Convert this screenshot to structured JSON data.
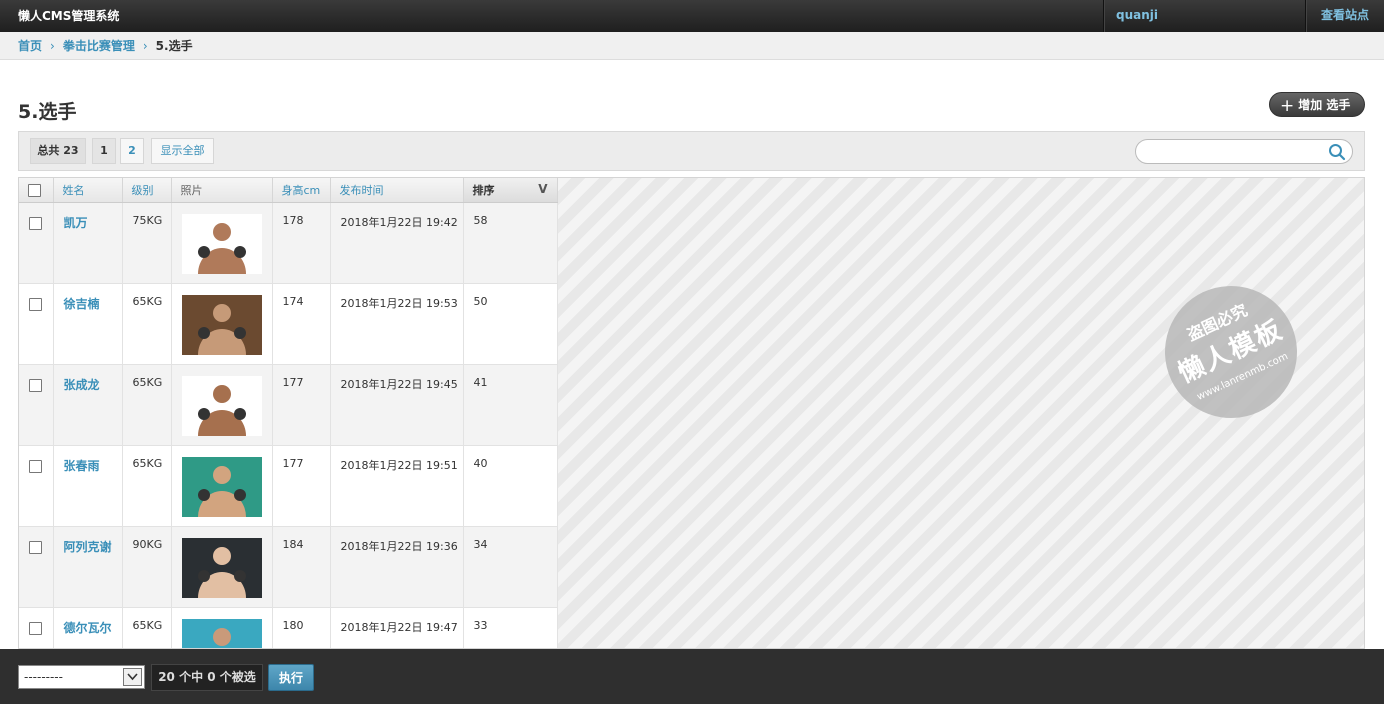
{
  "header": {
    "brand": "懒人CMS管理系统",
    "user": "quanji",
    "view_site": "查看站点"
  },
  "breadcrumb": {
    "home": "首页",
    "section": "拳击比赛管理",
    "current": "5.选手"
  },
  "page": {
    "title": "5.选手",
    "add_button": "增加 选手"
  },
  "toolbar": {
    "total": "总共 23",
    "page1": "1",
    "page2": "2",
    "show_all": "显示全部",
    "search_value": ""
  },
  "table": {
    "headers": {
      "name": "姓名",
      "weight": "级别",
      "photo": "照片",
      "height": "身高cm",
      "published": "发布时间",
      "order": "排序"
    },
    "rows": [
      {
        "name": "凯万",
        "weight": "75KG",
        "height": "178",
        "published": "2018年1月22日 19:42",
        "order": "58",
        "photo_bg": "#ffffff",
        "skin": "#b07a5a"
      },
      {
        "name": "徐吉楠",
        "weight": "65KG",
        "height": "174",
        "published": "2018年1月22日 19:53",
        "order": "50",
        "photo_bg": "#6b4a30",
        "skin": "#c69a78"
      },
      {
        "name": "张成龙",
        "weight": "65KG",
        "height": "177",
        "published": "2018年1月22日 19:45",
        "order": "41",
        "photo_bg": "#ffffff",
        "skin": "#a6704e"
      },
      {
        "name": "张春雨",
        "weight": "65KG",
        "height": "177",
        "published": "2018年1月22日 19:51",
        "order": "40",
        "photo_bg": "#2f9a86",
        "skin": "#d2a47f"
      },
      {
        "name": "阿列克谢",
        "weight": "90KG",
        "height": "184",
        "published": "2018年1月22日 19:36",
        "order": "34",
        "photo_bg": "#2a2f33",
        "skin": "#e2bfa3"
      },
      {
        "name": "德尔瓦尔",
        "weight": "65KG",
        "height": "180",
        "published": "2018年1月22日 19:47",
        "order": "33",
        "photo_bg": "#3aa8c0",
        "skin": "#c99a7a"
      }
    ]
  },
  "watermark": {
    "top": "盗图必究",
    "main": "懒人模板",
    "url": "www.lanrenmb.com"
  },
  "bottom": {
    "action_default": "---------",
    "selected_text": "20 个中 0 个被选",
    "run": "执行"
  }
}
